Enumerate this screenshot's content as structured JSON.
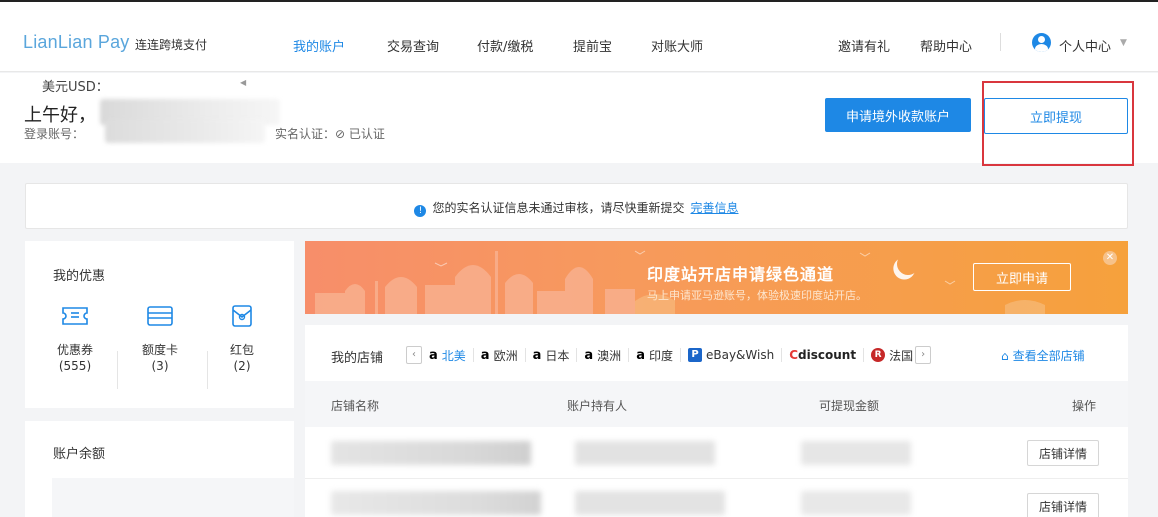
{
  "brand": {
    "logo": "LianLian Pay",
    "subtitle": "连连跨境支付"
  },
  "nav": {
    "items": [
      {
        "label": "我的账户",
        "active": true
      },
      {
        "label": "交易查询",
        "active": false
      },
      {
        "label": "付款/缴税",
        "active": false
      },
      {
        "label": "提前宝",
        "active": false
      },
      {
        "label": "对账大师",
        "active": false
      }
    ],
    "right": [
      {
        "label": "邀请有礼"
      },
      {
        "label": "帮助中心"
      }
    ],
    "user_center": "个人中心"
  },
  "greeting": {
    "title": "上午好，",
    "account_label": "登录账号：",
    "verify_label": "实名认证：",
    "verify_status": "⊘ 已认证"
  },
  "actions": {
    "apply": "申请境外收款账户",
    "withdraw": "立即提现"
  },
  "notice": {
    "text": "您的实名认证信息未通过审核，请尽快重新提交",
    "link": "完善信息"
  },
  "promo": {
    "title": "我的优惠",
    "items": [
      {
        "label": "优惠券",
        "count": "(555)",
        "icon": "coupon-icon"
      },
      {
        "label": "额度卡",
        "count": "(3)",
        "icon": "card-icon"
      },
      {
        "label": "红包",
        "count": "(2)",
        "icon": "red-packet-icon"
      }
    ]
  },
  "balance": {
    "title": "账户余额",
    "currency": "美元USD："
  },
  "banner": {
    "title": "印度站开店申请绿色通道",
    "subtitle": "马上申请亚马逊账号，体验极速印度站开店。",
    "button": "立即申请"
  },
  "stores": {
    "label": "我的店铺",
    "tabs": [
      {
        "label": "北美",
        "prefix": "a",
        "active": true
      },
      {
        "label": "欧洲",
        "prefix": "a"
      },
      {
        "label": "日本",
        "prefix": "a"
      },
      {
        "label": "澳洲",
        "prefix": "a"
      },
      {
        "label": "印度",
        "prefix": "a"
      },
      {
        "label": "eBay&Wish",
        "prefix": "P"
      },
      {
        "label": "Cdiscount",
        "prefix": "C"
      },
      {
        "label": "法国",
        "prefix": "R"
      }
    ],
    "view_all": "查看全部店铺",
    "columns": [
      "店铺名称",
      "账户持有人",
      "可提现金额",
      "操作"
    ],
    "row_action": "店铺详情"
  }
}
